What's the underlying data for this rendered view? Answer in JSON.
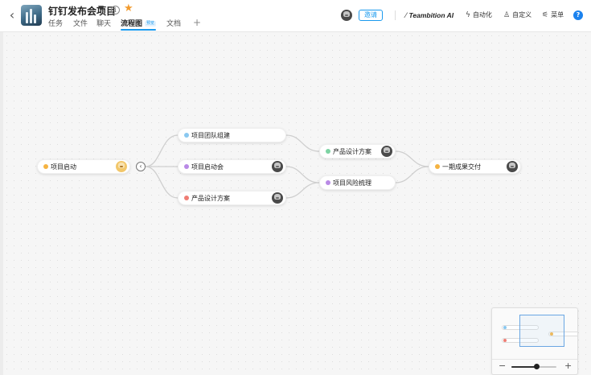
{
  "header": {
    "project_title": "钉钉发布会项目",
    "tabs": [
      {
        "label": "任务",
        "active": false
      },
      {
        "label": "文件",
        "active": false
      },
      {
        "label": "聊天",
        "active": false
      },
      {
        "label": "流程图",
        "active": true,
        "badge": "预览"
      },
      {
        "label": "文档",
        "active": false
      }
    ],
    "add_tab_symbol": "+",
    "invite_label": "邀请",
    "tools": [
      {
        "icon": "ai-spark-icon",
        "label": "Teambition AI"
      },
      {
        "icon": "lightning-icon",
        "label": "自动化"
      },
      {
        "icon": "flask-icon",
        "label": "自定义"
      },
      {
        "icon": "menu-sliders-icon",
        "label": "菜单"
      }
    ],
    "help_symbol": "?"
  },
  "colors": {
    "accent": "#1b9aee",
    "star": "#f29b2e",
    "dot_orange": "#f5b342",
    "dot_blue": "#8ac8f0",
    "dot_purple": "#b98ae6",
    "dot_red": "#ef7d74",
    "dot_green": "#7dd3a3"
  },
  "flow": {
    "nodes": [
      {
        "id": "start",
        "label": "项目启动",
        "dot": "orange",
        "avatar": "warm"
      },
      {
        "id": "team",
        "label": "项目团队组建",
        "dot": "blue",
        "avatar": null
      },
      {
        "id": "kickoff",
        "label": "项目启动会",
        "dot": "purple",
        "avatar": "gray"
      },
      {
        "id": "design1",
        "label": "产品设计方案",
        "dot": "red",
        "avatar": "gray"
      },
      {
        "id": "design2",
        "label": "产品设计方案",
        "dot": "green",
        "avatar": "gray"
      },
      {
        "id": "risk",
        "label": "项目风险梳理",
        "dot": "purple",
        "avatar": null
      },
      {
        "id": "deliver",
        "label": "一期成果交付",
        "dot": "orange",
        "avatar": "gray"
      }
    ],
    "collapse_symbol": "‹"
  },
  "minimap": {
    "zoom_minus": "−",
    "zoom_plus": "+",
    "zoom_level": 0.55
  }
}
